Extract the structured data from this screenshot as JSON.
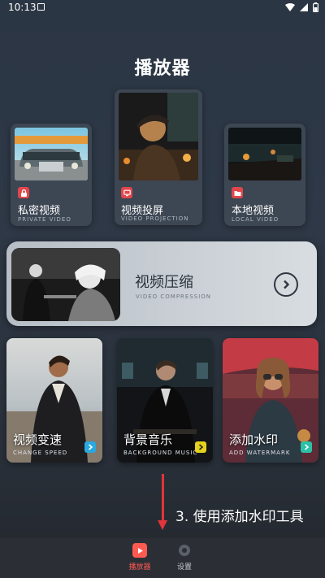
{
  "status": {
    "time": "10:13"
  },
  "app": {
    "title": "播放器"
  },
  "cards": [
    {
      "label": "私密视频",
      "sub": "PRIVATE VIDEO",
      "icon": "lock-icon"
    },
    {
      "label": "视频投屏",
      "sub": "VIDEO PROJECTION",
      "icon": "cast-icon"
    },
    {
      "label": "本地视频",
      "sub": "LOCAL VIDEO",
      "icon": "folder-icon"
    }
  ],
  "compress": {
    "label": "视频压缩",
    "sub": "VIDEO COMPRESSION"
  },
  "features": [
    {
      "label": "视频变速",
      "sub": "CHANGE SPEED",
      "accent": "#2aa8e0"
    },
    {
      "label": "背景音乐",
      "sub": "BACKGROUND MUSIC",
      "accent": "#e5d21c"
    },
    {
      "label": "添加水印",
      "sub": "ADD WATERMARK",
      "accent": "#2bc1a6"
    }
  ],
  "annotation": {
    "text": "3. 使用添加水印工具"
  },
  "nav": [
    {
      "label": "播放器",
      "active": true
    },
    {
      "label": "设置",
      "active": false
    }
  ],
  "colors": {
    "accent_red": "#e0474c",
    "nav_active": "#ff5a52",
    "annotation": "#e0353a"
  }
}
